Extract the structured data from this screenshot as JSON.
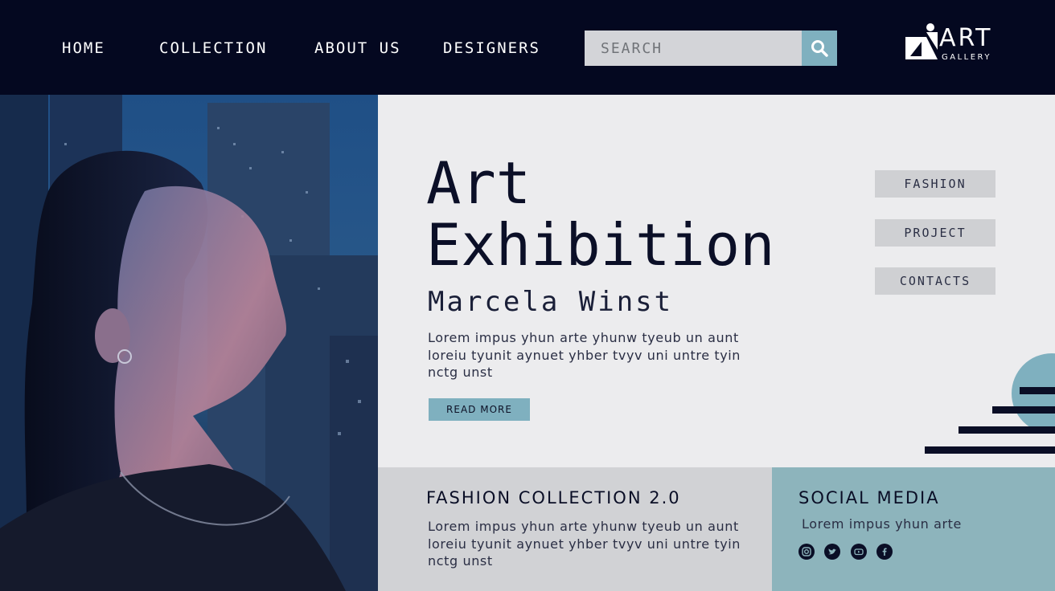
{
  "nav": {
    "items": [
      {
        "label": "HOME"
      },
      {
        "label": "COLLECTION"
      },
      {
        "label": "ABOUT US"
      },
      {
        "label": "DESIGNERS"
      }
    ]
  },
  "search": {
    "placeholder": "SEARCH",
    "icon": "search-icon"
  },
  "logo": {
    "text": "ART",
    "subtext": "GALLERY"
  },
  "hero": {
    "title_line1": "Art",
    "title_line2": "Exhibition",
    "subtitle": "Marcela Winst",
    "description": "Lorem impus yhun arte yhunw tyeub un aunt loreiu tyunit aynuet yhber tvyv uni untre tyin nctg unst",
    "read_more_label": "READ MORE"
  },
  "side_menu": {
    "items": [
      {
        "label": "FASHION"
      },
      {
        "label": "PROJECT"
      },
      {
        "label": "CONTACTS"
      }
    ]
  },
  "fashion": {
    "title": "FASHION COLLECTION 2.0",
    "description": "Lorem impus yhun arte yhunw tyeub un aunt loreiu tyunit aynuet yhber tvyv uni untre tyin nctg unst"
  },
  "social": {
    "title": "SOCIAL MEDIA",
    "description": "Lorem impus yhun arte",
    "icons": [
      "instagram-icon",
      "twitter-icon",
      "youtube-icon",
      "facebook-icon"
    ]
  },
  "colors": {
    "header_bg": "#040820",
    "accent": "#7fb0bf",
    "panel_bg": "#ececee",
    "text_dark": "#0a0e26"
  }
}
